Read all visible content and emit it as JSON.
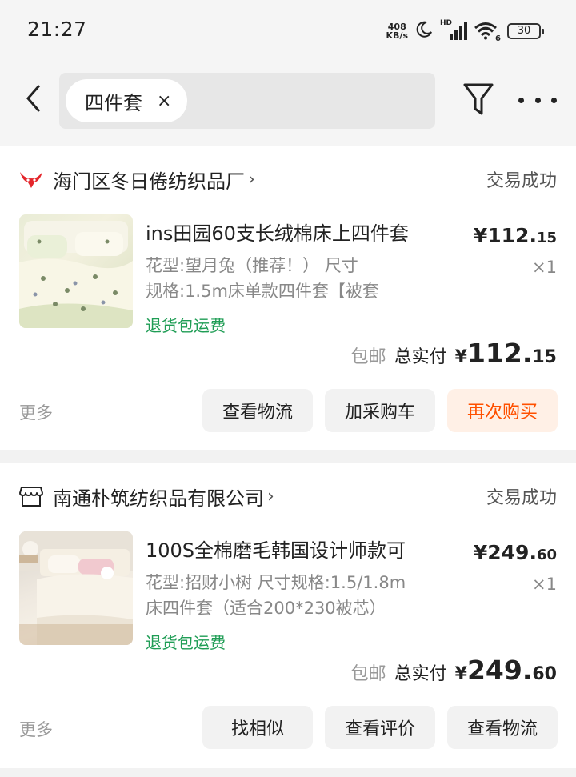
{
  "status_bar": {
    "time": "21:27",
    "net_speed_value": "408",
    "net_speed_unit": "KB/s",
    "signal_label": "HD",
    "wifi_label": "6",
    "battery": "30"
  },
  "top_bar": {
    "search_chip": "四件套",
    "chip_close": "×"
  },
  "orders": [
    {
      "store": "海门区冬日倦纺织品厂",
      "chevron": "›",
      "status": "交易成功",
      "title": "ins田园60支长绒棉床上四件套",
      "spec_line1": "花型:望月兔（推荐！） 尺寸",
      "spec_line2": "规格:1.5m床单款四件套【被套",
      "refund": "退货包运费",
      "unit_price_main": "¥112.",
      "unit_price_cents": "15",
      "qty": "×1",
      "free_ship": "包邮",
      "total_label": "总实付",
      "total_yen": "¥",
      "total_main": "112.",
      "total_cents": "15",
      "more": "更多",
      "buttons": [
        "查看物流",
        "加采购车",
        "再次购买"
      ]
    },
    {
      "store": "南通朴筑纺织品有限公司",
      "chevron": "›",
      "status": "交易成功",
      "title": "100S全棉磨毛韩国设计师款可",
      "spec_line1": "花型:招财小树 尺寸规格:1.5/1.8m",
      "spec_line2": "床四件套（适合200*230被芯）",
      "refund": "退货包运费",
      "unit_price_main": "¥249.",
      "unit_price_cents": "60",
      "qty": "×1",
      "free_ship": "包邮",
      "total_label": "总实付",
      "total_yen": "¥",
      "total_main": "249.",
      "total_cents": "60",
      "more": "更多",
      "buttons": [
        "找相似",
        "查看评价",
        "查看物流"
      ]
    }
  ],
  "colors": {
    "accent": "#ff5000",
    "accent_bg": "#fff0e6",
    "success_green": "#1f9d55",
    "store_logo_red": "#e4262b"
  },
  "icons": {
    "back": "back-arrow-icon",
    "filter": "filter-icon",
    "more": "more-dots-icon",
    "store1": "bull-logo-icon",
    "store2": "shop-icon",
    "moon": "moon-icon",
    "signal": "signal-icon",
    "wifi": "wifi-icon"
  }
}
